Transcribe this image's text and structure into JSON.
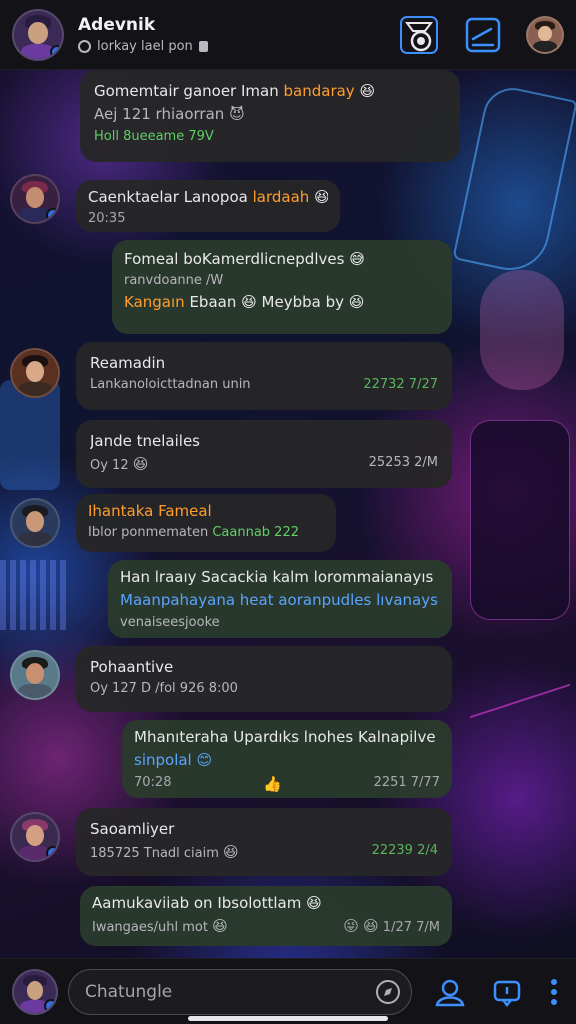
{
  "header": {
    "title": "Adevnik",
    "subtitle": "lorkay lael pon"
  },
  "messages": [
    {
      "l1": "Gomemtair ganoer Iman",
      "l1b": "bandaray",
      "l2": "Aej 121 rhiaorran",
      "l3": "Holl 8ueeame 79V"
    },
    {
      "l1": "Caenktaelar",
      "l1a": "Lanopoa",
      "l1b": "lardaah",
      "time": "20:35"
    },
    {
      "l1": "Fomeal boKamerdlicnepdlves",
      "l2": "ranvdoanne /W",
      "l3a": "Kangaın",
      "l3b": "Ebaan",
      "l3c": "Meybba by"
    },
    {
      "l1": "Reamadin",
      "l2": "Lankanoloicttadnan unin",
      "time": "22732 7/27"
    },
    {
      "l1": "Jande tnelailes",
      "l2": "Oy 12",
      "time": "25253 2/M"
    },
    {
      "l1": "Ihantaka Fameal",
      "l2a": "Iblor ponmematen",
      "l2b": "Caannab 222"
    },
    {
      "l1": "Han lraaıy Sacackia kalm lorommaianayıs",
      "l2": "Maanpahayana heat aoranpudles lıvanays",
      "l3": "venaiseesjooke"
    },
    {
      "l1": "Pohaantive",
      "l2": "Oy 127 D /fol 926 8:00"
    },
    {
      "l1": "Mhanıteraha Upardıks lnohes Kalnapilve",
      "l2": "sinpolal",
      "l3": "70:28",
      "time": "2251 7/77"
    },
    {
      "l1": "Saoamliyer",
      "l2": "185725 Tnadl ciaim",
      "time": "22239 2/4"
    },
    {
      "l1": "Aamukaviiab on Ibsolottlam",
      "l2": "Iwangaes/uhl mot",
      "time": "1/27 7/M"
    }
  ],
  "composer": {
    "placeholder": "Chatungle"
  },
  "colors": {
    "accent": "#5aa4ff",
    "highlight": "#ff9d2e",
    "success": "#5fcf66",
    "sent_bubble": "#2a3a2c",
    "received_bubble": "#262628"
  },
  "icons": [
    "camera-icon",
    "compose-icon",
    "profile-avatar",
    "lock-icon",
    "compass-icon",
    "user-icon",
    "chat-icon",
    "more-icon"
  ]
}
